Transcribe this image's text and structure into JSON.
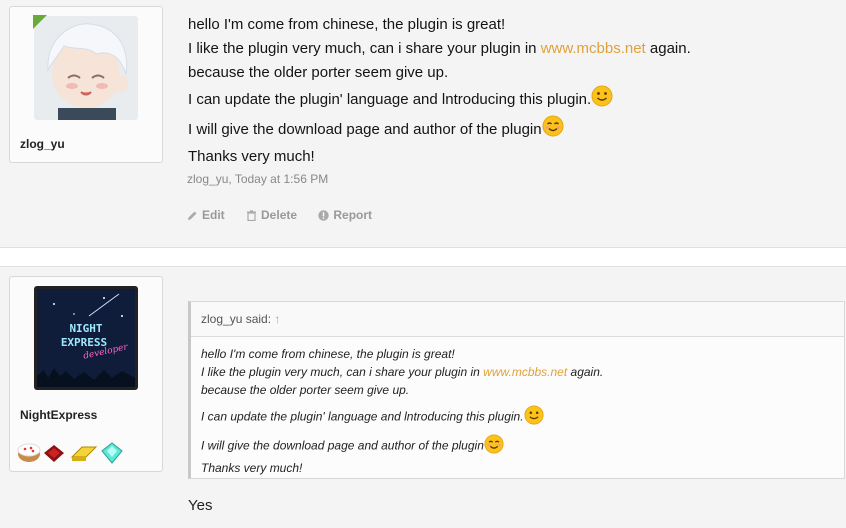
{
  "post1": {
    "username": "zlog_yu",
    "lines": {
      "l1": "hello I'm come from chinese, the plugin is great!",
      "l2_pre": "I like the plugin very much, can i share your plugin in ",
      "l2_link": "www.mcbbs.net",
      "l2_post": " again.",
      "l3": "because the older porter seem give up.",
      "l4": "I can update the plugin' language and lntroducing this plugin.",
      "l5": "I will give the download page and author of the plugin",
      "l6": "Thanks very much!"
    },
    "meta": "zlog_yu, Today at 1:56 PM",
    "actions": {
      "edit": "Edit",
      "delete": "Delete",
      "report": "Report"
    }
  },
  "post2": {
    "username": "NightExpress",
    "avatar_text": {
      "line1": "NIGHT",
      "line2": "EXPRESS",
      "line3": "developer"
    },
    "quote_author": "zlog_yu said:",
    "quote_up": "↑",
    "reply": "Yes"
  },
  "colors": {
    "link": "#e0a13c",
    "online": "#6aaa3a"
  },
  "icons": {
    "smile1": "slight-smile-icon",
    "smile2": "blush-smile-icon"
  }
}
